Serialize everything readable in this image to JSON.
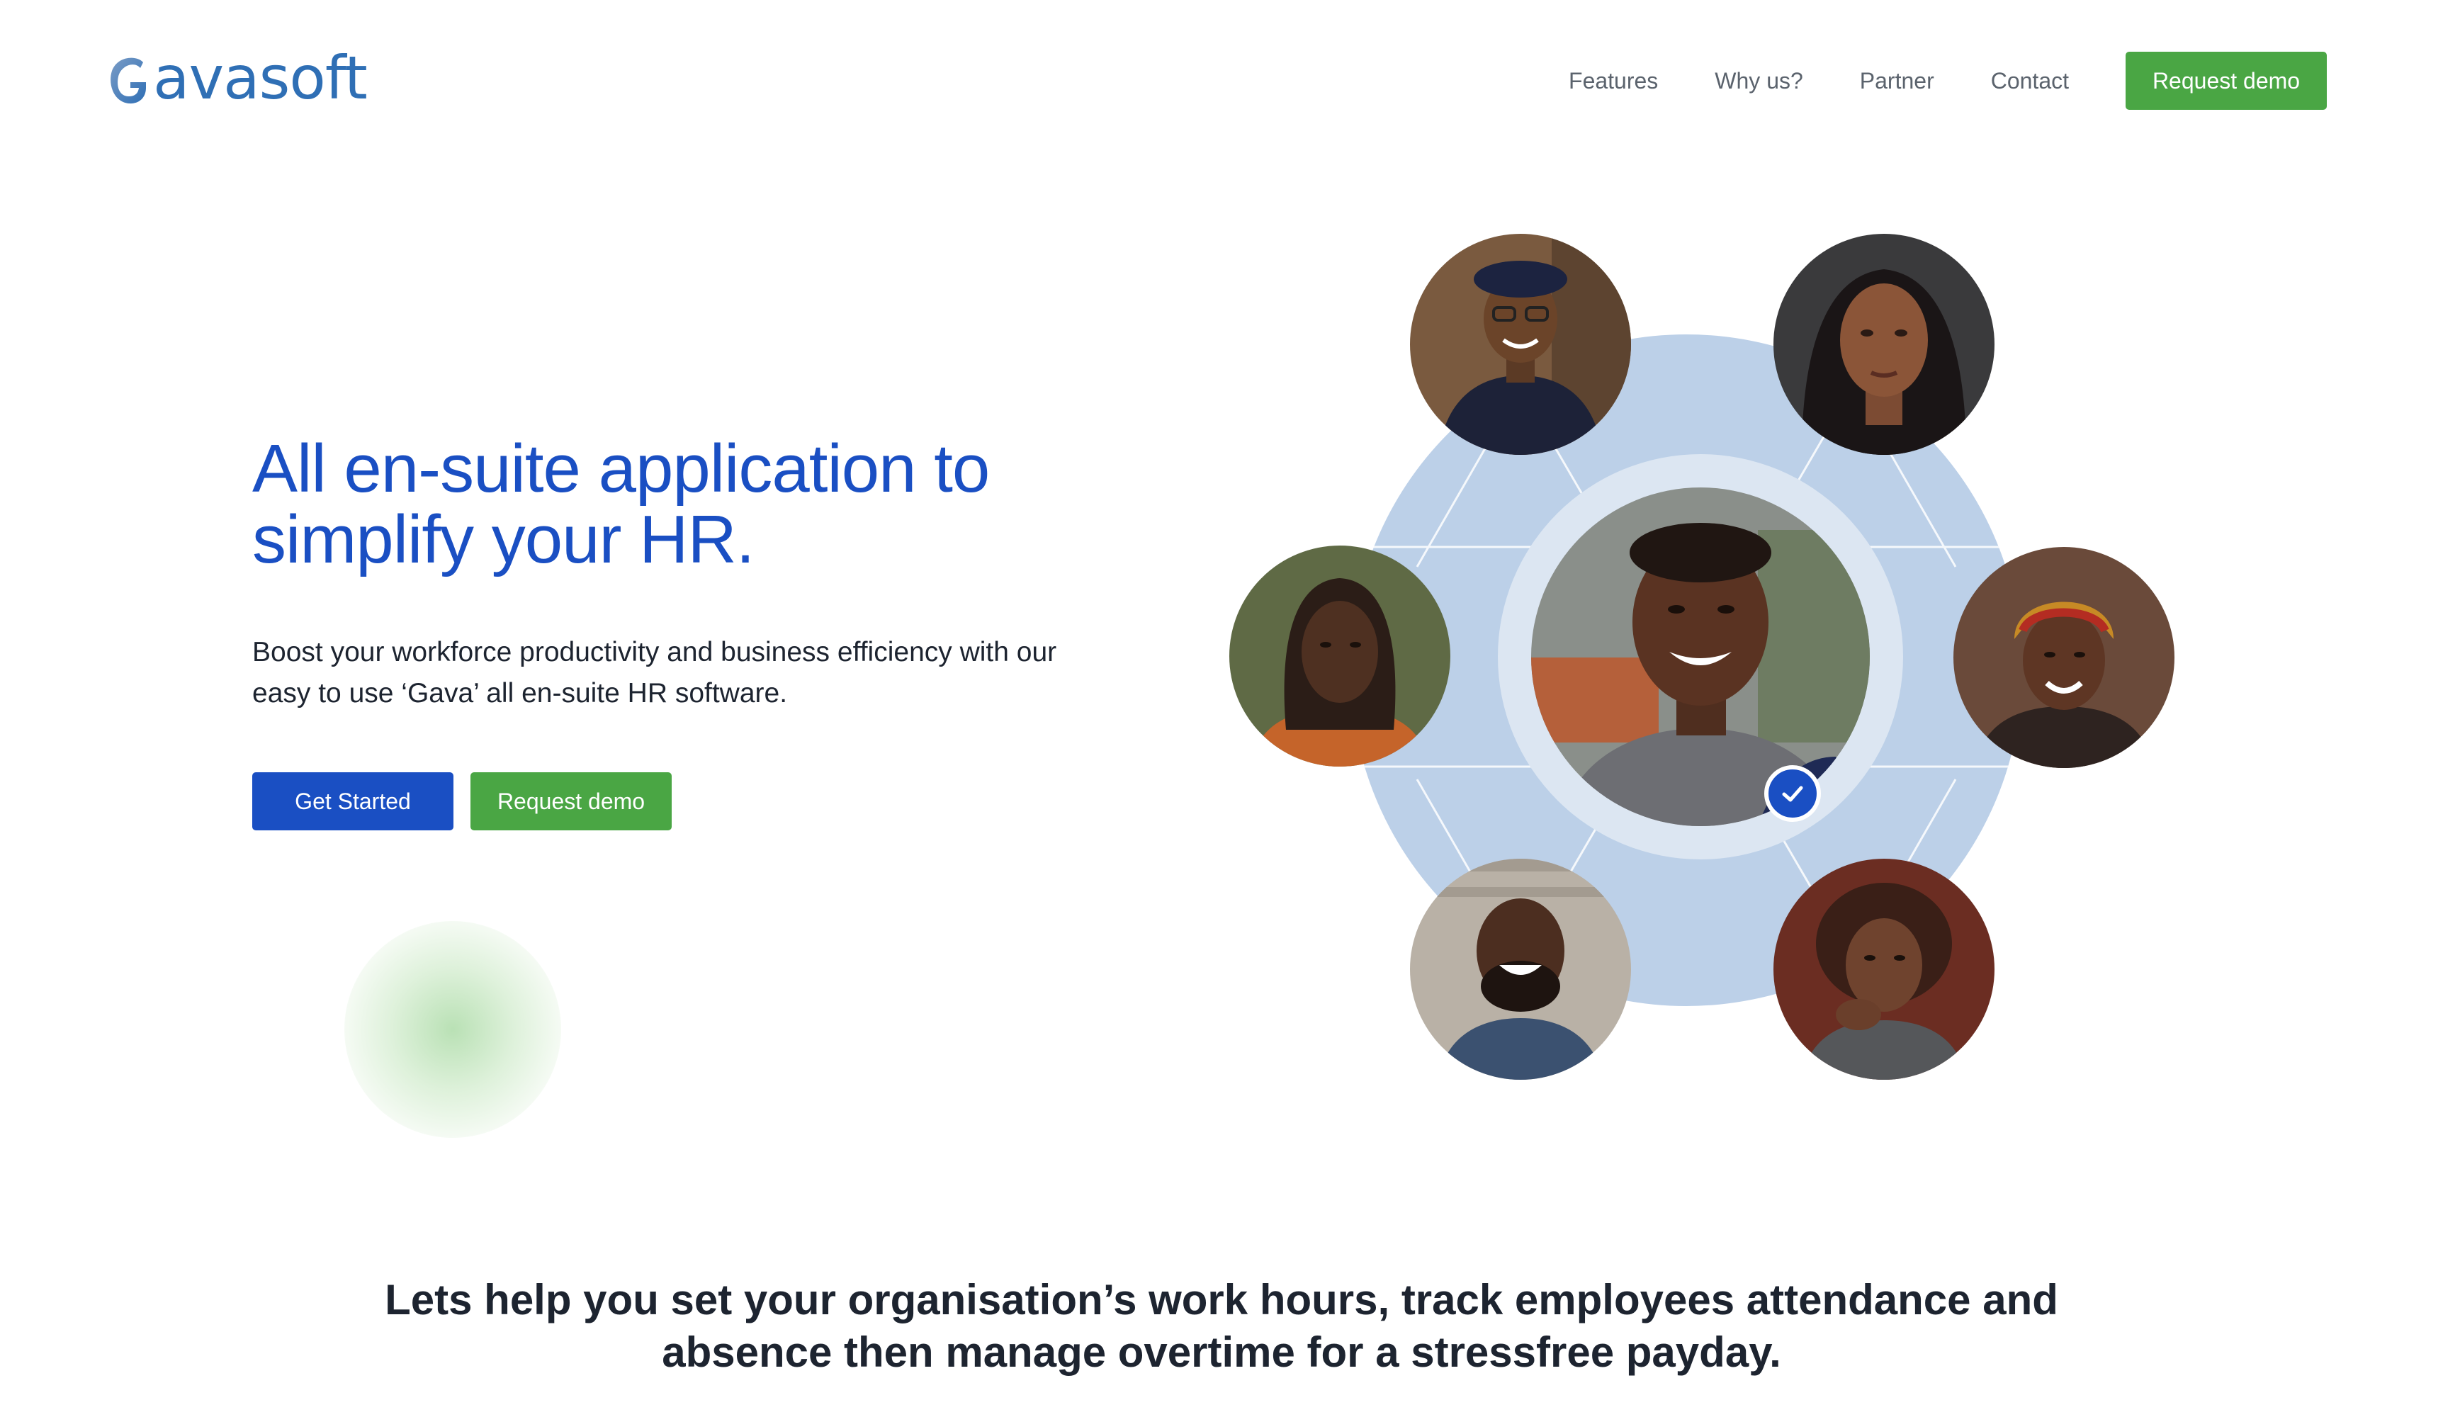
{
  "brand": {
    "logo_text": "avasoft",
    "logo_letter": "G",
    "primary_color": "#1a4fc3",
    "accent_color": "#4aa644",
    "logo_color": "#2f6fb5"
  },
  "nav": {
    "items": [
      {
        "label": "Features"
      },
      {
        "label": "Why us?"
      },
      {
        "label": "Partner"
      },
      {
        "label": "Contact"
      }
    ],
    "cta_label": "Request demo"
  },
  "hero": {
    "title": "All en-suite application to simplify your HR.",
    "subtitle": "Boost your workforce productivity and business efficiency with our easy to use ‘Gava’ all en-suite HR software.",
    "primary_button": "Get Started",
    "secondary_button": "Request demo"
  },
  "illustration": {
    "ring_color": "#bcd0e8",
    "center_ring_color": "#dce6f2",
    "icons": {
      "badge": "check-icon"
    }
  },
  "tagline": "Lets help you set your organisation’s work hours, track employees attendance and absence then manage overtime for a stressfree payday."
}
